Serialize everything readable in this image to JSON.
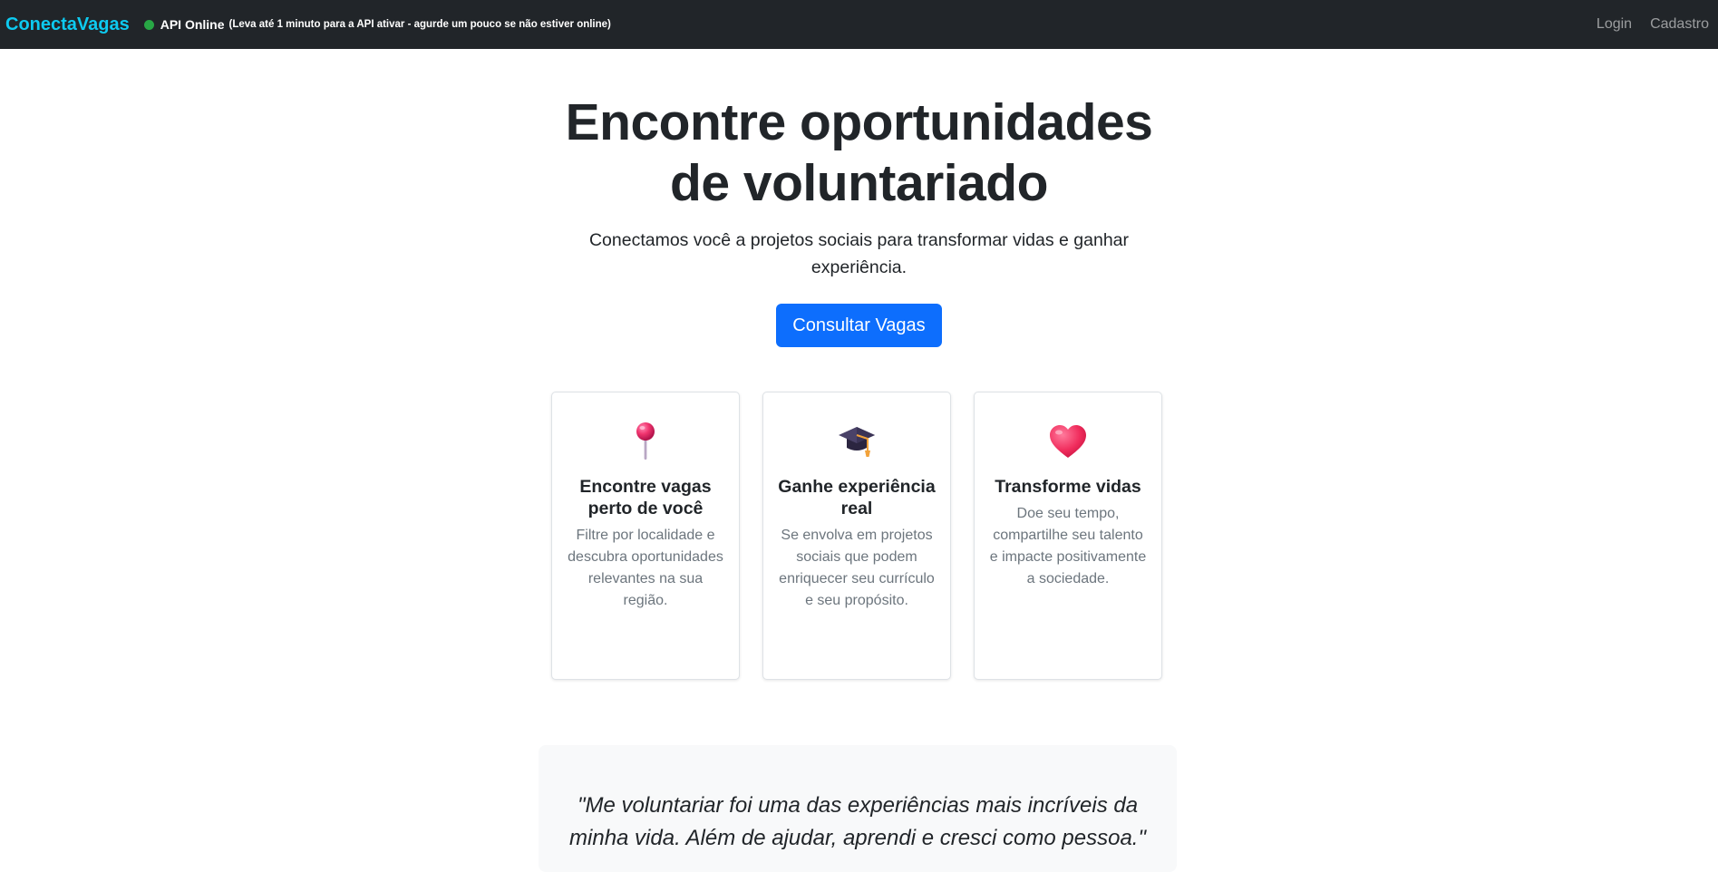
{
  "navbar": {
    "brand": "ConectaVagas",
    "api_status_label": "API Online",
    "api_status_note": "(Leva até 1 minuto para a API ativar - agurde um pouco se não estiver online)",
    "links": [
      {
        "label": "Login"
      },
      {
        "label": "Cadastro"
      }
    ]
  },
  "hero": {
    "title_line1": "Encontre oportunidades",
    "title_line2": "de voluntariado",
    "subtitle": "Conectamos você a projetos sociais para transformar vidas e ganhar experiência.",
    "cta_label": "Consultar Vagas"
  },
  "cards": [
    {
      "icon": "pushpin-icon",
      "title": "Encontre vagas perto de você",
      "text": "Filtre por localidade e descubra oportunidades relevantes na sua região."
    },
    {
      "icon": "graduation-cap-icon",
      "title": "Ganhe experiência real",
      "text": "Se envolva em projetos sociais que podem enriquecer seu currículo e seu propósito."
    },
    {
      "icon": "heart-icon",
      "title": "Transforme vidas",
      "text": "Doe seu tempo, compartilhe seu talento e impacte positivamente a sociedade."
    }
  ],
  "testimonial": {
    "quote": "\"Me voluntariar foi uma das experiências mais incríveis da minha vida. Além de ajudar, aprendi e cresci como pessoa.\""
  },
  "colors": {
    "navbar_bg": "#212529",
    "brand": "#0dcaf0",
    "status_online": "#28a745",
    "primary": "#0d6efd",
    "testimonial_bg": "#f8f9fa"
  }
}
